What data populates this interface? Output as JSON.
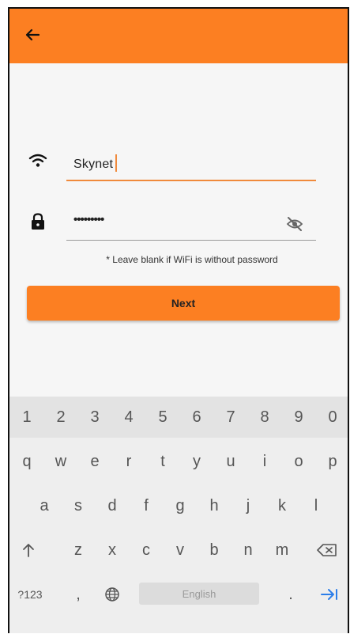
{
  "header": {
    "back_icon": "arrow-left-icon"
  },
  "form": {
    "ssid_icon": "wifi-icon",
    "ssid_value": "Skynet",
    "password_icon": "lock-icon",
    "password_masked": "•••••••••",
    "visibility_icon": "eye-off-icon",
    "hint": "* Leave blank if WiFi is without password",
    "next_label": "Next"
  },
  "keyboard": {
    "number_row": [
      "1",
      "2",
      "3",
      "4",
      "5",
      "6",
      "7",
      "8",
      "9",
      "0"
    ],
    "row1": [
      "q",
      "w",
      "e",
      "r",
      "t",
      "y",
      "u",
      "i",
      "o",
      "p"
    ],
    "row2": [
      "a",
      "s",
      "d",
      "f",
      "g",
      "h",
      "j",
      "k",
      "l"
    ],
    "row3": [
      "z",
      "x",
      "c",
      "v",
      "b",
      "n",
      "m"
    ],
    "shift_icon": "shift-arrow-icon",
    "backspace_icon": "backspace-icon",
    "symbols_label": "?123",
    "comma_label": ",",
    "globe_icon": "globe-icon",
    "space_label": "English",
    "period_label": ".",
    "enter_icon": "tab-arrow-icon"
  },
  "colors": {
    "accent": "#fc7f22",
    "background": "#f6f6f6",
    "keyboard": "#eeeeee"
  }
}
